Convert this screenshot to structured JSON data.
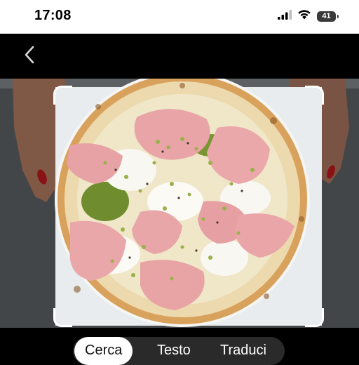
{
  "status_bar": {
    "time": "17:08",
    "battery": "41",
    "icons": [
      "cellular-signal-icon",
      "wifi-icon",
      "battery-icon"
    ]
  },
  "nav": {
    "back_icon": "chevron-left-icon"
  },
  "photo": {
    "subject": "pizza-image"
  },
  "modes": {
    "items": [
      {
        "label": "Cerca",
        "active": true
      },
      {
        "label": "Testo",
        "active": false
      },
      {
        "label": "Traduci",
        "active": false
      }
    ]
  },
  "colors": {
    "accent": "#ffffff",
    "nav_background": "#000000"
  }
}
